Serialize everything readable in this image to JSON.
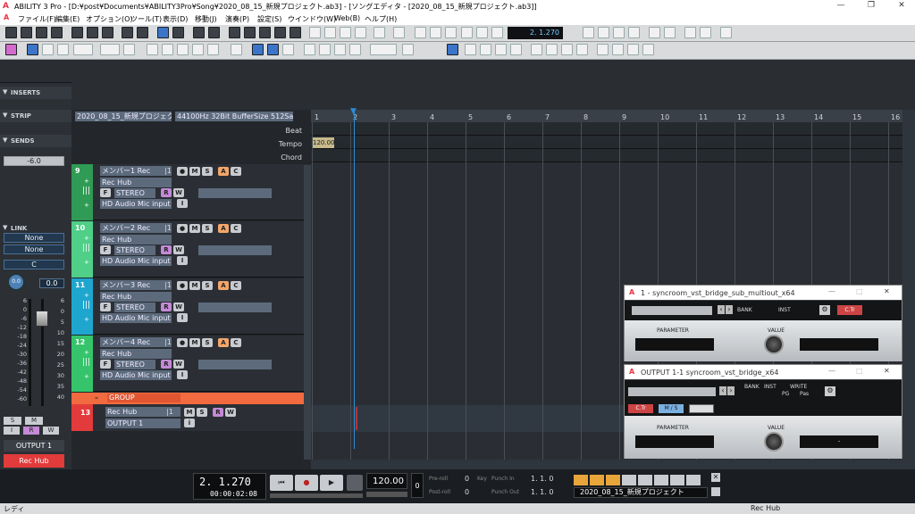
{
  "window": {
    "title": "ABILITY 3 Pro - [D:¥post¥Documents¥ABILITY3Pro¥Song¥2020_08_15_新規プロジェクト.ab3] - [ソングエディタ - [2020_08_15_新規プロジェクト.ab3]]"
  },
  "menu": [
    "ファイル(F)",
    "編集(E)",
    "オプション(O)",
    "ツール(T)",
    "表示(D)",
    "移動(J)",
    "演奏(P)",
    "設定(S)",
    "ウインドウ(W)",
    "Web(B)",
    "ヘルプ(H)"
  ],
  "toolbar": {
    "position": "2.  1.270"
  },
  "left_panel": {
    "inserts": "INSERTS",
    "strip": "STRIP",
    "sends": "SENDS",
    "sends_value": "-6.0",
    "link": "LINK",
    "link_a": "None",
    "link_b": "None",
    "pan_center": "C",
    "knob_value": "0.0",
    "fader_value": "0.0",
    "scale_left": [
      "6",
      "0",
      "-6",
      "-12",
      "-18",
      "-24",
      "-30",
      "-36",
      "-42",
      "-48",
      "-54",
      "-60"
    ],
    "scale_right": [
      "6",
      "0",
      "5",
      "10",
      "15",
      "20",
      "25",
      "30",
      "35",
      "40"
    ],
    "btn_s": "S",
    "btn_m": "M",
    "btn_i": "I",
    "btn_r": "R",
    "btn_w": "W",
    "output": "OUTPUT 1",
    "rec_hub": "Rec Hub"
  },
  "track_header": {
    "project": "2020_08_15_新規プロジェクト",
    "info": "44100Hz 32Bit BufferSize 512Sa...",
    "beat": "Beat",
    "tempo": "Tempo",
    "chord": "Chord",
    "tempo_value": "120.00"
  },
  "tracks": [
    {
      "num": "9",
      "name": "メンバー1 Rec",
      "ch": "|1",
      "hub": "Rec Hub",
      "stereo": "STEREO",
      "input": "HD Audio Mic input ...",
      "color": "#2f9b54"
    },
    {
      "num": "10",
      "name": "メンバー2 Rec",
      "ch": "|1",
      "hub": "Rec Hub",
      "stereo": "STEREO",
      "input": "HD Audio Mic input ...",
      "color": "#4fcf88"
    },
    {
      "num": "11",
      "name": "メンバー3 Rec",
      "ch": "|1",
      "hub": "Rec Hub",
      "stereo": "STEREO",
      "input": "HD Audio Mic input ...",
      "color": "#1ea6cf"
    },
    {
      "num": "12",
      "name": "メンバー4 Rec",
      "ch": "|1",
      "hub": "Rec Hub",
      "stereo": "STEREO",
      "input": "HD Audio Mic input ...",
      "color": "#35c46b"
    }
  ],
  "track_buttons": {
    "rec": "●",
    "m": "M",
    "s": "S",
    "a": "A",
    "c": "C",
    "f": "F",
    "r": "R",
    "w": "W",
    "i": "I"
  },
  "group": {
    "label": "GROUP",
    "num": "13",
    "hub": "Rec Hub",
    "ch": "|1",
    "output": "OUTPUT 1",
    "m": "M",
    "s": "S",
    "r": "R",
    "w": "W"
  },
  "ruler": [
    "1",
    "2",
    "3",
    "4",
    "5",
    "6",
    "7",
    "8",
    "9",
    "10",
    "11",
    "12",
    "13",
    "14",
    "15",
    "16"
  ],
  "plugin1": {
    "title": "1 - syncroom_vst_bridge_sub_multiout_x64",
    "bank": "BANK",
    "inst": "INST",
    "ctr": "C.Tr",
    "parameter": "PARAMETER",
    "value": "VALUE"
  },
  "plugin2": {
    "title": "OUTPUT 1-1 syncroom_vst_bridge_x64",
    "bank": "BANK",
    "inst": "INST",
    "write": "WRITE",
    "pg": "PG",
    "pas": "Pas",
    "ctr": "C.Tr",
    "ms": "M / S",
    "parameter": "PARAMETER",
    "value": "VALUE",
    "dot": "."
  },
  "transport": {
    "position": "2.  1.270",
    "time": "00:00:02:08",
    "tempo": "120.00",
    "zero": "0",
    "preroll": "Pre-roll",
    "postroll": "Post-roll",
    "preroll_val": "0",
    "postroll_val": "0",
    "key": "Key",
    "punch_in": "Punch In",
    "punch_out": "Punch Out",
    "punch_in_val": "1. 1.  0",
    "punch_out_val": "1. 1.  0",
    "project": "2020_08_15_新規プロジェクト"
  },
  "status": {
    "left": "レディ",
    "right": "Rec Hub"
  }
}
